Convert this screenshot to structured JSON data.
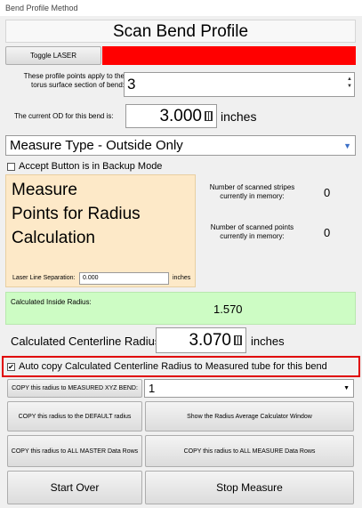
{
  "window": {
    "title": "Bend Profile Method"
  },
  "header": {
    "title": "Scan Bend Profile"
  },
  "laser": {
    "toggle_label": "Toggle LASER",
    "indicator_color": "#ff0000"
  },
  "points_field": {
    "label_line1": "These profile points apply to the",
    "label_line2": "torus surface section of bend:",
    "value": "3"
  },
  "od_field": {
    "label": "The current OD for this bend is:",
    "value": "3.000",
    "unit": "inches"
  },
  "measure_type": {
    "selected": "Measure Type - Outside Only"
  },
  "backup": {
    "label": "Accept Button is in Backup Mode",
    "checked": false
  },
  "instruction": {
    "line1": "Measure",
    "line2": "Points for Radius",
    "line3": "Calculation",
    "bg_color": "#fde9c8"
  },
  "laser_sep": {
    "label": "Laser Line Separation:",
    "value": "0.000",
    "unit": "inches"
  },
  "stripes": {
    "label_line1": "Number of scanned stripes",
    "label_line2": "currently in memory:",
    "value": "0"
  },
  "points": {
    "label_line1": "Number of scanned points",
    "label_line2": "currently in memory:",
    "value": "0"
  },
  "inside_radius": {
    "label": "Calculated Inside Radius:",
    "value": "1.570",
    "bg_color": "#cdfcc4"
  },
  "centerline": {
    "label": "Calculated Centerline Radius",
    "value": "3.070",
    "unit": "inches"
  },
  "auto_copy": {
    "label": "Auto copy Calculated Centerline Radius to Measured tube for this bend",
    "checked": true,
    "highlight_color": "#e00000"
  },
  "copy_xyz": {
    "button_label": "COPY this radius to MEASURED XYZ BEND:",
    "selected": "1"
  },
  "buttons": {
    "copy_default": "COPY this radius to the DEFAULT radius",
    "avg_calc": "Show the Radius Average Calculator Window",
    "copy_master": "COPY this radius to ALL MASTER Data Rows",
    "copy_measure": "COPY this radius to ALL MEASURE Data Rows",
    "start_over": "Start Over",
    "stop_measure": "Stop Measure"
  }
}
